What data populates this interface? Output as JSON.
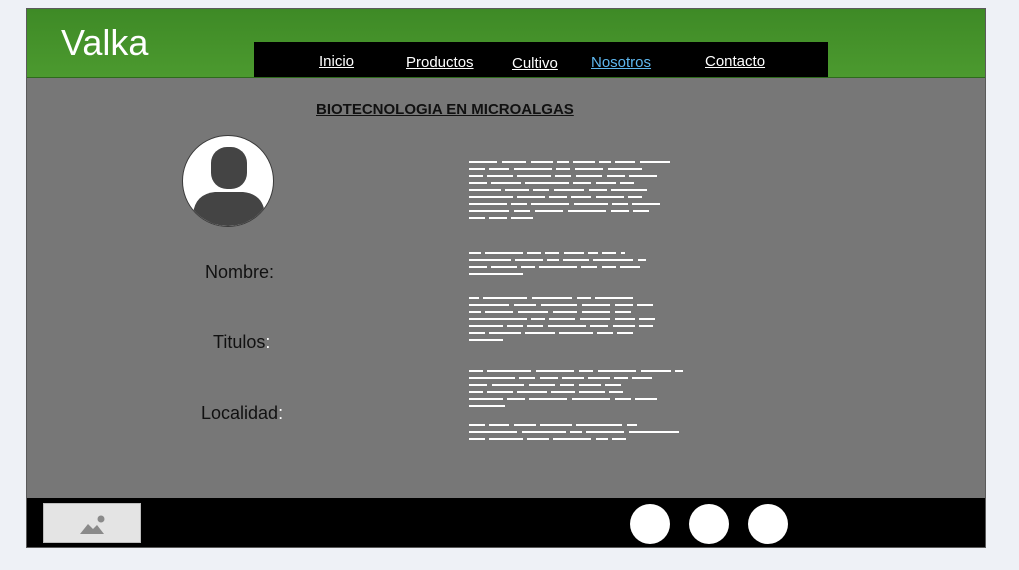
{
  "brand": {
    "logo": "Valka"
  },
  "nav": {
    "items": [
      {
        "label": "Inicio"
      },
      {
        "label": "Productos"
      },
      {
        "label": "Cultivo"
      },
      {
        "label": "Nosotros",
        "active": true
      },
      {
        "label": "Contacto"
      }
    ],
    "active_color": "#5fb8f0"
  },
  "main": {
    "title": "BIOTECNOLOGIA EN MICROALGAS",
    "profile": {
      "avatar_icon": "user-avatar-icon",
      "fields": [
        {
          "label": "Nombre",
          "colon": ":"
        },
        {
          "label": "Titulos",
          "colon": ":"
        },
        {
          "label": "Localidad",
          "colon": ":"
        }
      ]
    },
    "placeholder_text_paragraphs": 5
  },
  "footer": {
    "image_placeholder_icon": "image-placeholder-icon",
    "social_buttons": [
      "social-button-1",
      "social-button-2",
      "social-button-3"
    ]
  },
  "colors": {
    "header_green": "#4c9a2f",
    "content_gray": "#777777",
    "nav_black": "#000000",
    "footer_black": "#000000"
  }
}
